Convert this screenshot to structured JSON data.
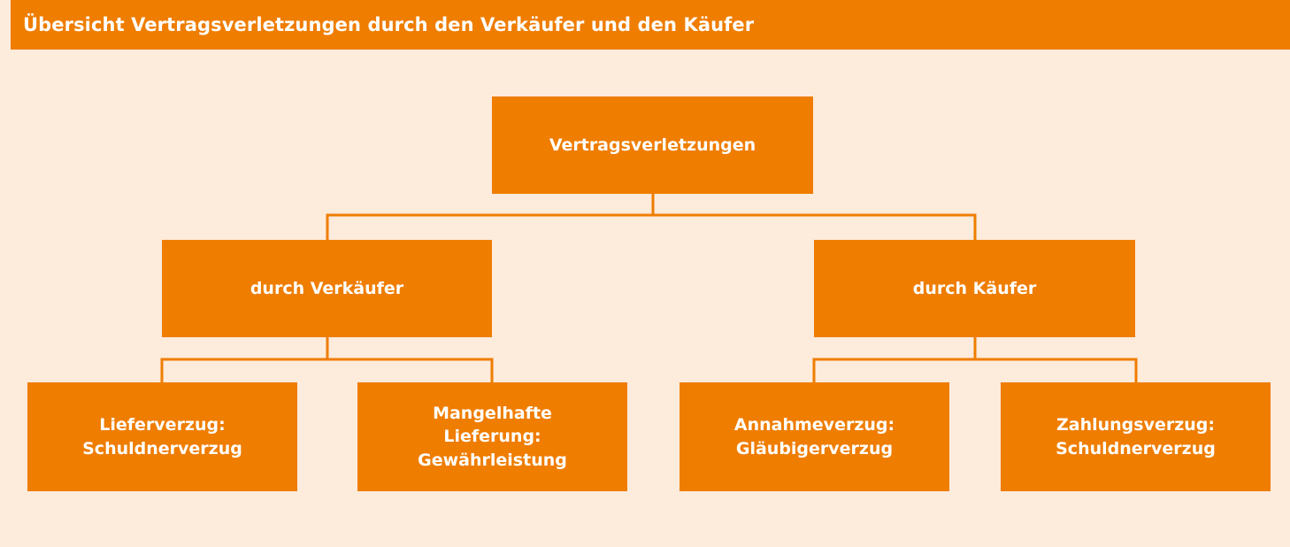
{
  "header": {
    "title": "Übersicht Vertragsverletzungen durch den Verkäufer und den Käufer"
  },
  "diagram": {
    "root": {
      "label": "Vertragsverletzungen"
    },
    "branches": [
      {
        "label": "durch Verkäufer",
        "children": [
          {
            "lines": [
              "Lieferverzug:",
              "Schuldnerverzug"
            ]
          },
          {
            "lines": [
              "Mangelhafte",
              "Lieferung:",
              "Gewährleistung"
            ]
          }
        ]
      },
      {
        "label": "durch Käufer",
        "children": [
          {
            "lines": [
              "Annahmeverzug:",
              "Gläubigerverzug"
            ]
          },
          {
            "lines": [
              "Zahlungsverzug:",
              "Schuldnerverzug"
            ]
          }
        ]
      }
    ]
  },
  "colors": {
    "accent": "#ef7d00",
    "background": "#fdebdc",
    "text_on_accent": "#ffffff"
  }
}
